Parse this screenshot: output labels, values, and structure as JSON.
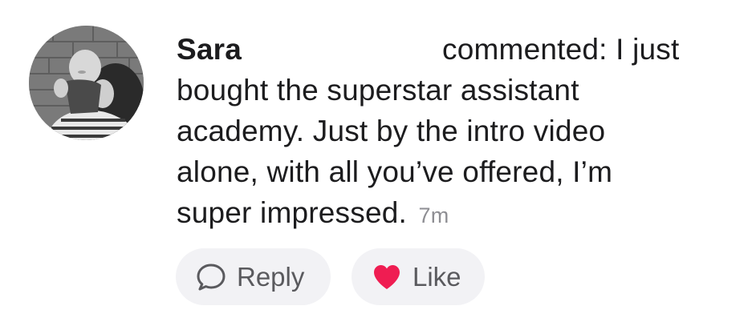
{
  "comment": {
    "author": "Sara",
    "verb": "commented: I just",
    "text_lines": [
      "bought the superstar assistant",
      "academy. Just by the intro video",
      "alone, with all you’ve offered, I’m",
      "super impressed."
    ],
    "timestamp": "7m",
    "avatar_icon": "user-photo-avatar"
  },
  "actions": {
    "reply_label": "Reply",
    "reply_icon": "speech-bubble-icon",
    "like_label": "Like",
    "like_icon": "heart-icon",
    "like_color": "#ef1d52"
  }
}
